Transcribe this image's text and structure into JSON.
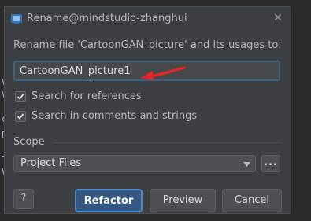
{
  "window": {
    "title": "Rename@mindstudio-zhanghui",
    "app_icon": "mindstudio-app-icon",
    "close_icon": "close-icon"
  },
  "dialog": {
    "prompt": "Rename file 'CartoonGAN_picture' and its usages to:",
    "new_name_value": "CartoonGAN_picture1",
    "annotation": {
      "icon": "red-arrow-icon",
      "color": "#e32626"
    },
    "options": [
      {
        "label": "Search for references",
        "checked": true
      },
      {
        "label": "Search in comments and strings",
        "checked": true
      }
    ],
    "scope": {
      "label": "Scope",
      "selected": "Project Files",
      "browse_label": "..."
    },
    "buttons": {
      "help": "?",
      "refactor": "Refactor",
      "preview": "Preview",
      "cancel": "Cancel"
    }
  },
  "background": {
    "editor_chars": [
      "V",
      "V",
      "c",
      "D",
      "T",
      "V"
    ]
  },
  "colors": {
    "dialog_bg": "#3c3f41",
    "accent": "#365880",
    "focus_border": "#3d6185",
    "text": "#bbbbbb"
  }
}
